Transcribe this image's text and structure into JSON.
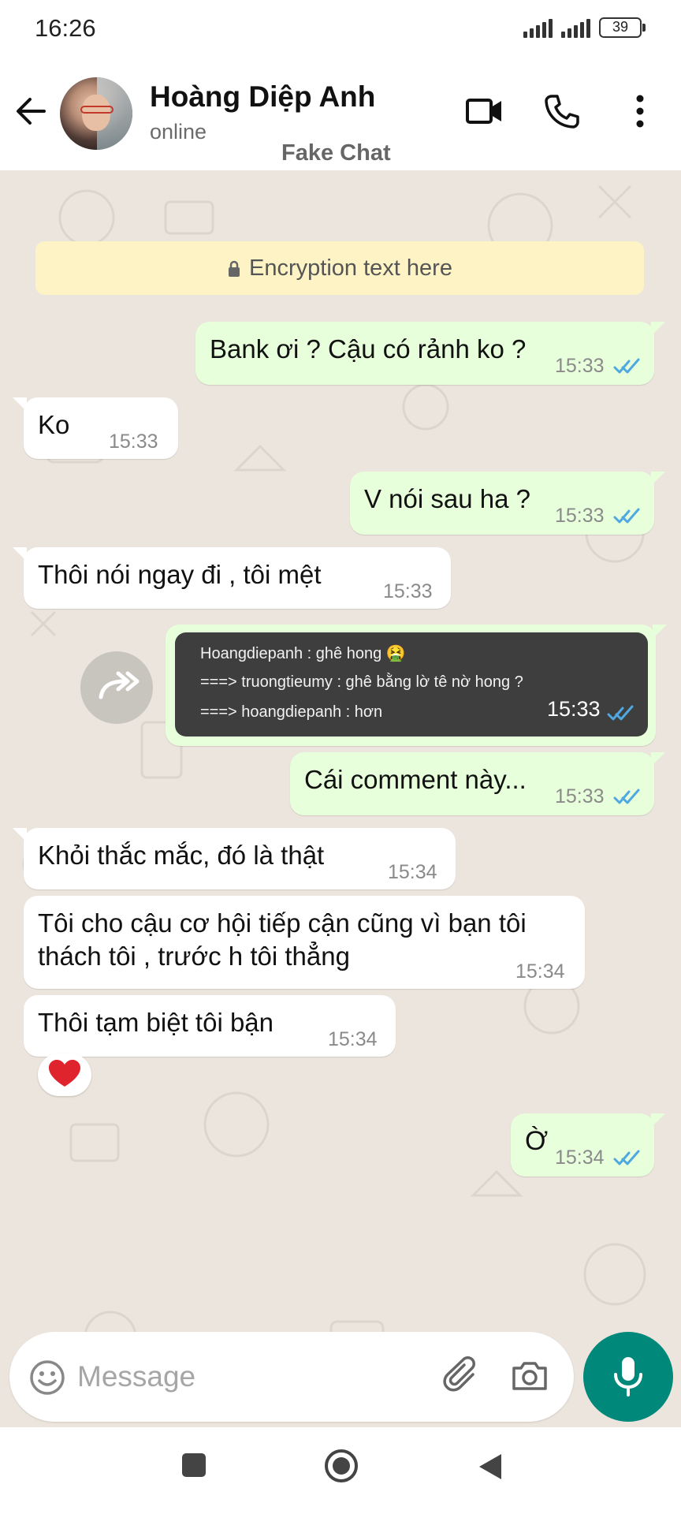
{
  "status_bar": {
    "time": "16:26",
    "battery": "39"
  },
  "header": {
    "contact_name": "Hoàng Diệp Anh",
    "contact_status": "online",
    "watermark": "Fake Chat"
  },
  "encryption_notice": "Encryption text here",
  "messages": [
    {
      "direction": "out",
      "text": "Bank ơi ? Cậu có rảnh ko ?",
      "time": "15:33",
      "read": true
    },
    {
      "direction": "in",
      "text": "Ko",
      "time": "15:33"
    },
    {
      "direction": "out",
      "text": "V nói sau ha ?",
      "time": "15:33",
      "read": true
    },
    {
      "direction": "in",
      "text": "Thôi nói ngay đi , tôi mệt",
      "time": "15:33"
    },
    {
      "direction": "out",
      "type": "image",
      "image_lines": [
        "Hoangdiepanh : ghê hong 🤮",
        "===> truongtieumy : ghê bằng lờ tê nờ hong ?",
        "===> hoangdiepanh : hơn"
      ],
      "time": "15:33",
      "read": true
    },
    {
      "direction": "out",
      "text": "Cái comment này...",
      "time": "15:33",
      "read": true
    },
    {
      "direction": "in",
      "text": "Khỏi thắc mắc, đó là thật",
      "time": "15:34"
    },
    {
      "direction": "in",
      "lines": [
        "Tôi cho cậu cơ hội tiếp cận cũng vì bạn tôi",
        "thách  tôi , trước h tôi thẳng"
      ],
      "time": "15:34"
    },
    {
      "direction": "in",
      "text": "Thôi tạm biệt tôi bận",
      "time": "15:34",
      "reaction": "❤️"
    },
    {
      "direction": "out",
      "text": "Ờ",
      "time": "15:34",
      "read": true
    }
  ],
  "input": {
    "placeholder": "Message"
  },
  "colors": {
    "outgoing": "#e7ffdb",
    "incoming": "#ffffff",
    "chat_bg": "#ece5dd",
    "accent": "#00897b",
    "read_ticks": "#4fa8e0"
  },
  "icons": [
    "back-arrow-icon",
    "video-call-icon",
    "phone-icon",
    "more-vert-icon",
    "lock-icon",
    "forward-icon",
    "emoji-icon",
    "attach-icon",
    "camera-icon",
    "mic-icon"
  ]
}
